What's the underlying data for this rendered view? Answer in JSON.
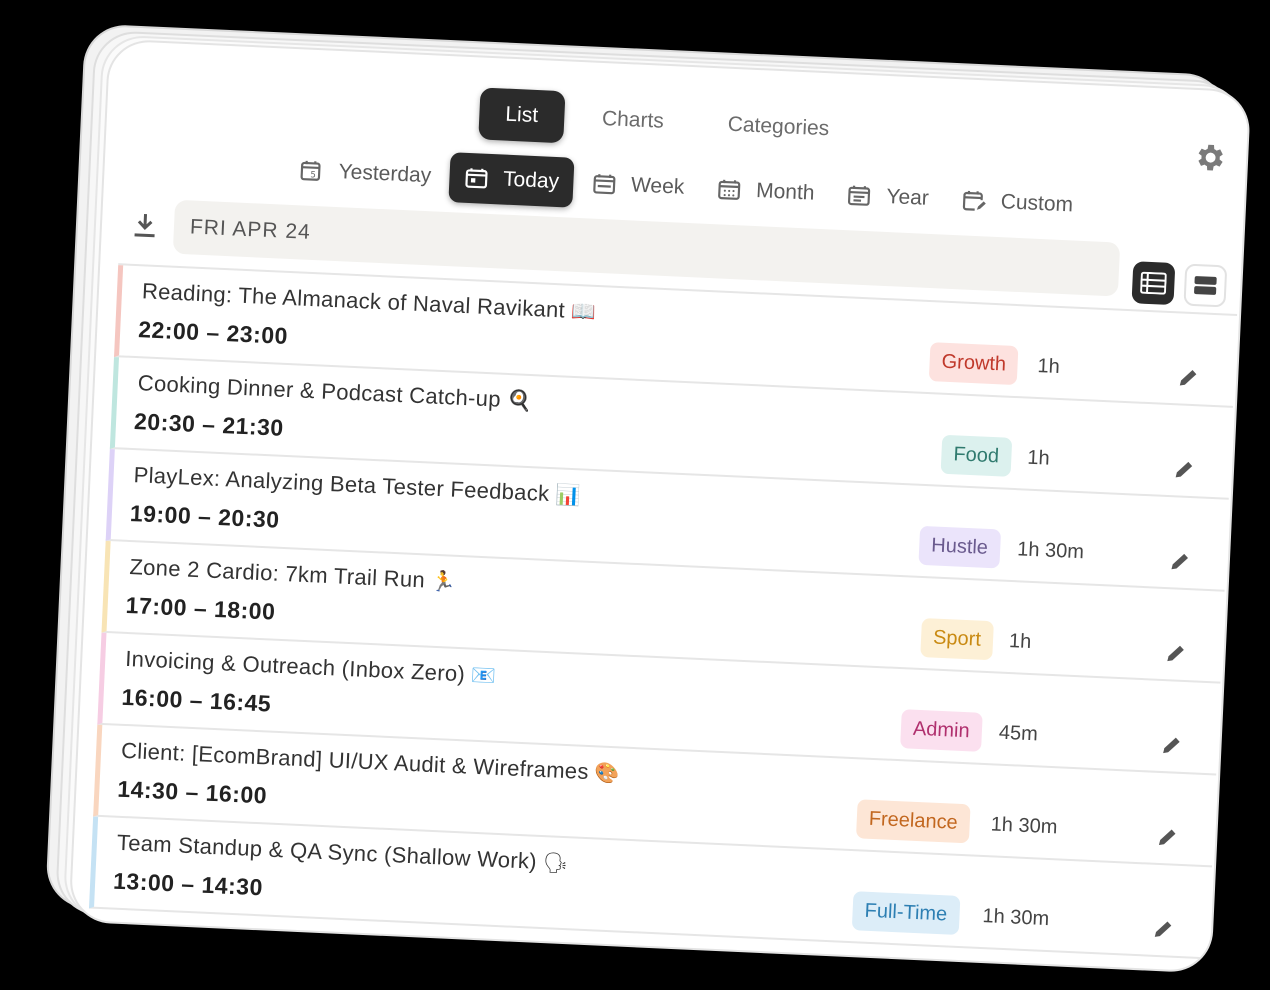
{
  "view_tabs": [
    {
      "label": "List",
      "active": true
    },
    {
      "label": "Charts",
      "active": false
    },
    {
      "label": "Categories",
      "active": false
    }
  ],
  "ranges": [
    {
      "label": "Yesterday",
      "icon": "calendar-back-icon",
      "active": false
    },
    {
      "label": "Today",
      "icon": "calendar-today-icon",
      "active": true
    },
    {
      "label": "Week",
      "icon": "calendar-week-icon",
      "active": false
    },
    {
      "label": "Month",
      "icon": "calendar-month-icon",
      "active": false
    },
    {
      "label": "Year",
      "icon": "calendar-year-icon",
      "active": false
    },
    {
      "label": "Custom",
      "icon": "calendar-edit-icon",
      "active": false
    }
  ],
  "date_bar": {
    "label": "FRI APR 24"
  },
  "entries": [
    {
      "title": "Reading: The Almanack of Naval Ravikant",
      "emoji": "📖",
      "time": "22:00 – 23:00",
      "tag": "Growth",
      "duration": "1h",
      "tag_bg": "#fde2df",
      "tag_fg": "#c0392b",
      "bar_color": "#f5c6c0"
    },
    {
      "title": "Cooking Dinner & Podcast Catch-up",
      "emoji": "🍳",
      "time": "20:30 – 21:30",
      "tag": "Food",
      "duration": "1h",
      "tag_bg": "#dcf1ee",
      "tag_fg": "#2f7a6e",
      "bar_color": "#bfe6df"
    },
    {
      "title": "PlayLex: Analyzing Beta Tester Feedback",
      "emoji": "📊",
      "time": "19:00 – 20:30",
      "tag": "Hustle",
      "duration": "1h 30m",
      "tag_bg": "#ebe4fb",
      "tag_fg": "#6a5a8e",
      "bar_color": "#ddd2f7"
    },
    {
      "title": "Zone 2 Cardio: 7km Trail Run",
      "emoji": "🏃",
      "time": "17:00 – 18:00",
      "tag": "Sport",
      "duration": "1h",
      "tag_bg": "#fdf0d6",
      "tag_fg": "#c98a12",
      "bar_color": "#f8e4b5"
    },
    {
      "title": "Invoicing & Outreach (Inbox Zero)",
      "emoji": "📧",
      "time": "16:00 – 16:45",
      "tag": "Admin",
      "duration": "45m",
      "tag_bg": "#fbe0ef",
      "tag_fg": "#b0306e",
      "bar_color": "#f6cde3"
    },
    {
      "title": "Client: [EcomBrand] UI/UX Audit & Wireframes",
      "emoji": "🎨",
      "time": "14:30 – 16:00",
      "tag": "Freelance",
      "duration": "1h 30m",
      "tag_bg": "#fde6d6",
      "tag_fg": "#c2671f",
      "bar_color": "#f9d6bf"
    },
    {
      "title": "Team Standup & QA Sync (Shallow Work)",
      "emoji": "🗣",
      "time": "13:00 – 14:30",
      "tag": "Full-Time",
      "duration": "1h 30m",
      "tag_bg": "#dcedf8",
      "tag_fg": "#2d7fb3",
      "bar_color": "#c5e2f4"
    }
  ]
}
